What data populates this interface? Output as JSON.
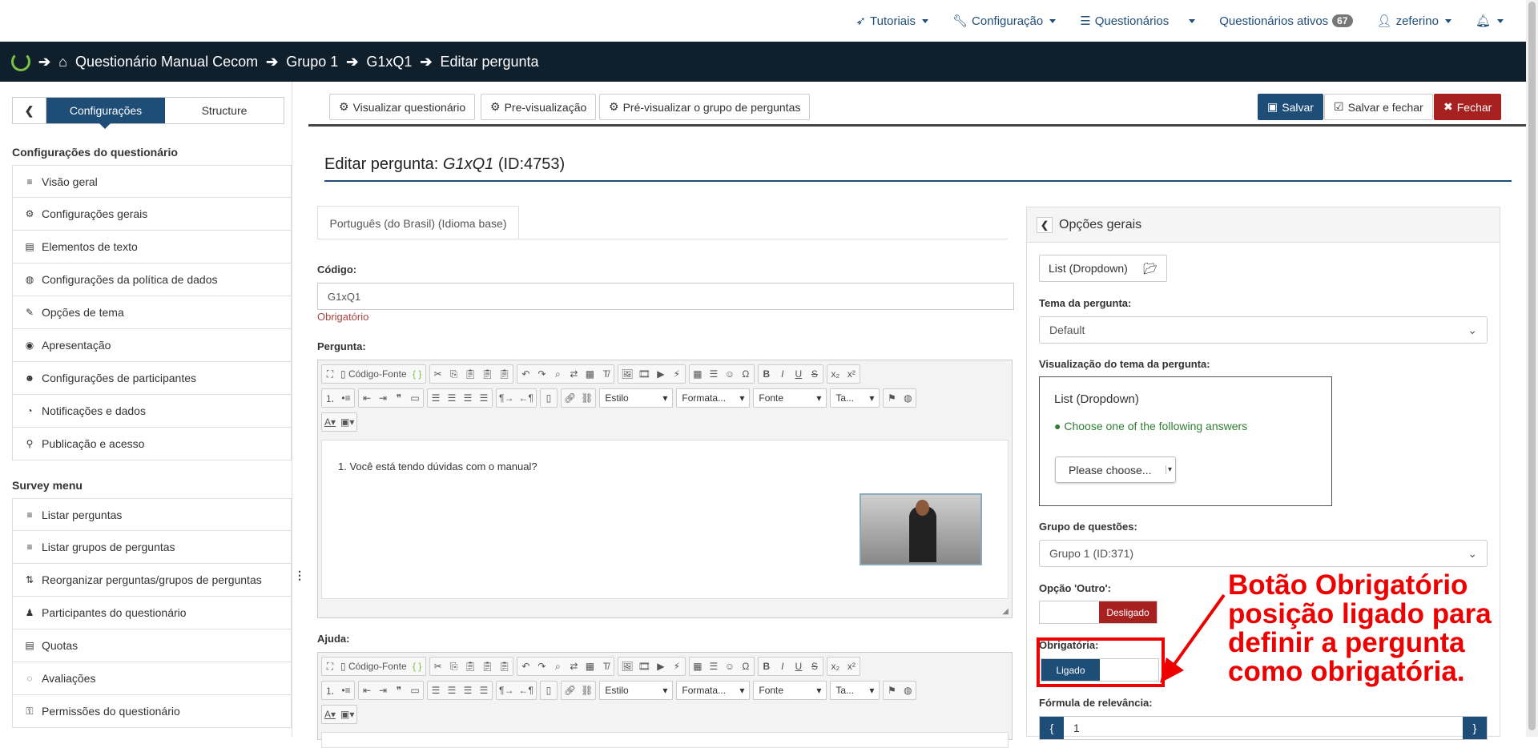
{
  "topnav": {
    "tutorials": "Tutoriais",
    "config": "Configuração",
    "surveys": "Questionários",
    "active_surveys": "Questionários ativos",
    "active_count": "67",
    "user": "zeferino"
  },
  "breadcrumb": {
    "home": "Questionário Manual Cecom",
    "group": "Grupo 1",
    "question": "G1xQ1",
    "current": "Editar pergunta"
  },
  "sidebar": {
    "tab_settings": "Configurações",
    "tab_structure": "Structure",
    "section1": "Configurações do questionário",
    "items1": [
      {
        "icon": "≡",
        "label": "Visão geral"
      },
      {
        "icon": "⚙",
        "label": "Configurações gerais"
      },
      {
        "icon": "▤",
        "label": "Elementos de texto"
      },
      {
        "icon": "◍",
        "label": "Configurações da política de dados"
      },
      {
        "icon": "✎",
        "label": "Opções de tema"
      },
      {
        "icon": "◉",
        "label": "Apresentação"
      },
      {
        "icon": "☻",
        "label": "Configurações de participantes"
      },
      {
        "icon": "◔",
        "label": "Notificações e dados"
      },
      {
        "icon": "⚲",
        "label": "Publicação e acesso"
      }
    ],
    "section2": "Survey menu",
    "items2": [
      {
        "icon": "≡",
        "label": "Listar perguntas"
      },
      {
        "icon": "≡",
        "label": "Listar grupos de perguntas"
      },
      {
        "icon": "⇅",
        "label": "Reorganizar perguntas/grupos de perguntas"
      },
      {
        "icon": "♟",
        "label": "Participantes do questionário"
      },
      {
        "icon": "▤",
        "label": "Quotas"
      },
      {
        "icon": "◌",
        "label": "Avaliações"
      },
      {
        "icon": "⚿",
        "label": "Permissões do questionário"
      }
    ]
  },
  "toolbar": {
    "view_survey": "Visualizar questionário",
    "preview": "Pre-visualização",
    "preview_group": "Pré-visualizar o grupo de perguntas",
    "save": "Salvar",
    "save_close": "Salvar e fechar",
    "close": "Fechar"
  },
  "page": {
    "title_prefix": "Editar pergunta:",
    "title_code": "G1xQ1",
    "title_id": "(ID:4753)",
    "lang_tab": "Português (do Brasil) (Idioma base)",
    "code_label": "Código:",
    "code_value": "G1xQ1",
    "required_note": "Obrigatório",
    "question_label": "Pergunta:",
    "question_text": "1. Você está tendo dúvidas com o manual?",
    "help_label": "Ajuda:"
  },
  "editor": {
    "source": "Código-Fonte",
    "style": "Estilo",
    "format": "Formata...",
    "font": "Fonte",
    "size": "Ta..."
  },
  "right_panel": {
    "title": "Opções gerais",
    "qtype": "List (Dropdown)",
    "theme_label": "Tema da pergunta:",
    "theme_value": "Default",
    "theme_preview_label": "Visualização do tema da pergunta:",
    "preview_title": "List (Dropdown)",
    "preview_hint": "Choose one of the following answers",
    "preview_select": "Please choose...",
    "group_label": "Grupo de questões:",
    "group_value": "Grupo 1 (ID:371)",
    "other_label": "Opção 'Outro':",
    "other_state": "Desligado",
    "mandatory_label": "Obrigatória:",
    "mandatory_state": "Ligado",
    "relevance_label": "Fórmula de relevância:",
    "relevance_value": "1"
  },
  "annotation": {
    "text": "Botão Obrigatório posição ligado para definir a pergunta como obrigatória.",
    "color": "#e00000"
  },
  "colors": {
    "primary": "#1e4d78",
    "danger": "#a72121",
    "header_bg": "#0f1f2c"
  }
}
